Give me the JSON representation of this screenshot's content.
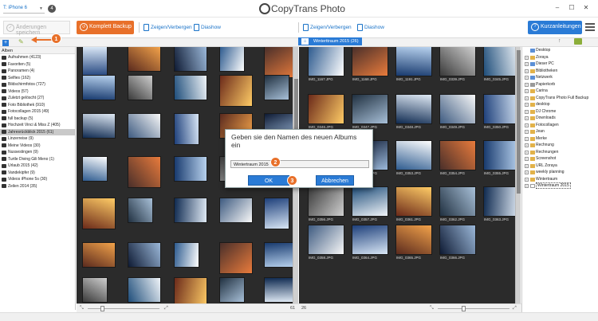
{
  "titlebar": {
    "device": "T: iPhone 6",
    "device_badge": "4",
    "logo_text": "CopyTrans Photo",
    "minimize": "–",
    "maximize": "☐",
    "close": "✕"
  },
  "toolbar": {
    "save_label": "Änderungen speichern",
    "backup_label": "Komplett Backup",
    "show_hide_label": "Zeigen/Verbergen",
    "slideshow_label": "Diashow",
    "show_hide_label_right": "Zeigen/Verbergen",
    "slideshow_label_right": "Diashow",
    "help_label": "Kurzanleitungen",
    "help_icon": "question-icon",
    "menu_icon": "hamburger-icon"
  },
  "markers": {
    "one": "1",
    "two": "2",
    "three": "3"
  },
  "sidebar": {
    "header": "Alben",
    "albums": [
      {
        "label": "Aufnahmen (4123)"
      },
      {
        "label": "Favoriten (5)"
      },
      {
        "label": "Panoramen (4)"
      },
      {
        "label": "Selfies (162)"
      },
      {
        "label": "Bildschirmfotos (727)"
      },
      {
        "label": "Videos (57)"
      },
      {
        "label": "Zuletzt gelöscht (27)"
      },
      {
        "label": "Foto Bibliothek (910)"
      },
      {
        "label": "Fotocollagen 2015 (49)"
      },
      {
        "label": "full backup (5)"
      },
      {
        "label": "Hochzeit Vinci & Miss Z (405)"
      },
      {
        "label": "Jahresrückblick 2015 (61)"
      },
      {
        "label": "Linzerreise (9)"
      },
      {
        "label": "Meine Videos (30)"
      },
      {
        "label": "Nussestingen (9)"
      },
      {
        "label": "Turtle Diving Gili Meno (1)"
      },
      {
        "label": "Urlaub 2015 (42)"
      },
      {
        "label": "Vandekipfer (9)"
      },
      {
        "label": "Videos iPhone 5s (30)"
      },
      {
        "label": "Zeilen 2014 (35)"
      }
    ]
  },
  "right_album_tab": "Winterttraum 2015 (26)",
  "right_captions": [
    "IMG_1167.JPG",
    "IMG_1168.JPG",
    "IMG_1191.JPG",
    "IMG_0339.JPG",
    "IMG_0345.JPG",
    "IMG_0346.JPG",
    "IMG_0347.JPG",
    "IMG_0348.JPG",
    "IMG_0349.JPG",
    "IMG_0350.JPG",
    "IMG_0351.JPG",
    "IMG_0352.JPG",
    "IMG_0353.JPG",
    "IMG_0354.JPG",
    "IMG_0355.JPG",
    "IMG_0356.JPG",
    "IMG_0357.JPG",
    "IMG_0361.JPG",
    "IMG_0362.JPG",
    "IMG_0363.JPG",
    "IMG_0358.JPG",
    "IMG_0364.JPG",
    "IMG_0365.JPG",
    "IMG_0366.JPG"
  ],
  "left_bottom": {
    "count": "61"
  },
  "right_bottom": {
    "count": "26"
  },
  "tree": {
    "nodes": [
      {
        "label": "Desktop",
        "color": "#5b8fd6"
      },
      {
        "label": "Zoraya",
        "color": "#e2b24a"
      },
      {
        "label": "Dieser PC",
        "color": "#5b8fd6"
      },
      {
        "label": "Bibliotheken",
        "color": "#e2b24a"
      },
      {
        "label": "Netzwerk",
        "color": "#5b8fd6"
      },
      {
        "label": "Papierkorb",
        "color": "#999999"
      },
      {
        "label": "Carina",
        "color": "#e2b24a"
      },
      {
        "label": "CopyTrans Photo Full Backup",
        "color": "#e2b24a"
      },
      {
        "label": "desktop",
        "color": "#e2b24a"
      },
      {
        "label": "DJ Chrome",
        "color": "#e2b24a"
      },
      {
        "label": "Downloads",
        "color": "#e2b24a"
      },
      {
        "label": "Fotocollagen",
        "color": "#e2b24a"
      },
      {
        "label": "Jean",
        "color": "#e2b24a"
      },
      {
        "label": "Merke",
        "color": "#e2b24a"
      },
      {
        "label": "Rechnung",
        "color": "#e2b24a"
      },
      {
        "label": "Rechnungen",
        "color": "#e2b24a"
      },
      {
        "label": "Screenshot",
        "color": "#e2b24a"
      },
      {
        "label": "URL Zoraya",
        "color": "#e2b24a"
      },
      {
        "label": "weekly planning",
        "color": "#e2b24a"
      },
      {
        "label": "Wintertraum",
        "color": "#e2b24a"
      },
      {
        "label": "Wintertraum 2015",
        "color": "#ffffff"
      }
    ]
  },
  "dialog": {
    "title": "Geben sie den Namen des neuen Albums ein",
    "input_value": "Wintertraum 2015",
    "ok_label": "OK",
    "cancel_label": "Abbrechen"
  }
}
